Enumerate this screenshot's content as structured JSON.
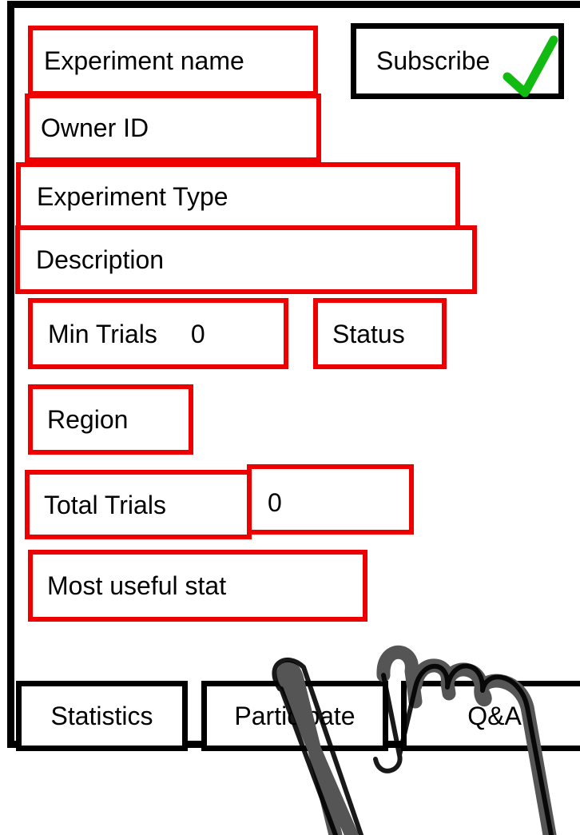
{
  "experiment": {
    "name_label": "Experiment name",
    "owner_label": "Owner ID",
    "type_label": "Experiment Type",
    "description_label": "Description",
    "min_trials_label": "Min Trials",
    "min_trials_value": "0",
    "status_label": "Status",
    "region_label": "Region",
    "total_trials_label": "Total Trials",
    "total_trials_value": "0",
    "stat_label": "Most useful stat"
  },
  "subscribe": {
    "label": "Subscribe",
    "icon": "checkmark-icon",
    "icon_color": "#11bb11"
  },
  "tabs": [
    {
      "label": "Statistics"
    },
    {
      "label": "Participate"
    },
    {
      "label": "Q&A"
    }
  ],
  "colors": {
    "field_border": "#ee0000",
    "frame_border": "#000000",
    "hand": "#555555"
  },
  "gesture": {
    "icon": "pointing-hand-icon"
  }
}
